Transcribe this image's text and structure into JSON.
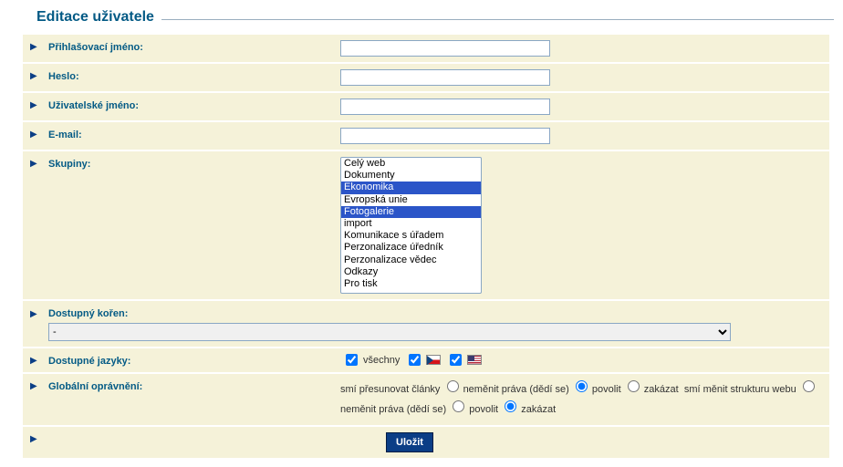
{
  "page": {
    "title": "Editace uživatele"
  },
  "labels": {
    "login": "Přihlašovací jméno:",
    "password": "Heslo:",
    "username": "Uživatelské jméno:",
    "email": "E-mail:",
    "groups": "Skupiny:",
    "root": "Dostupný kořen:",
    "languages": "Dostupné jazyky:",
    "permissions": "Globální oprávnění:"
  },
  "values": {
    "login": "",
    "password": "",
    "username": "",
    "email": ""
  },
  "groups": {
    "options": [
      "Celý web",
      "Dokumenty",
      "Ekonomika",
      "Evropská unie",
      "Fotogalerie",
      "import",
      "Komunikace s úřadem",
      "Perzonalizace úředník",
      "Perzonalizace vědec",
      "Odkazy",
      "Pro tisk"
    ],
    "selected": [
      "Ekonomika",
      "Fotogalerie"
    ]
  },
  "root": {
    "selected": "-"
  },
  "languages": {
    "all_label": "všechny",
    "all_checked": true,
    "cz_checked": true,
    "us_checked": true
  },
  "permissions": {
    "move_label": "smí přesunovat články",
    "struct_label": "smí měnit strukturu webu",
    "radio": {
      "inherit": "neměnit práva (dědí se)",
      "allow": "povolit",
      "deny": "zakázat"
    },
    "move_selected": "allow",
    "struct_selected": "deny"
  },
  "submit": {
    "label": "Uložit"
  }
}
